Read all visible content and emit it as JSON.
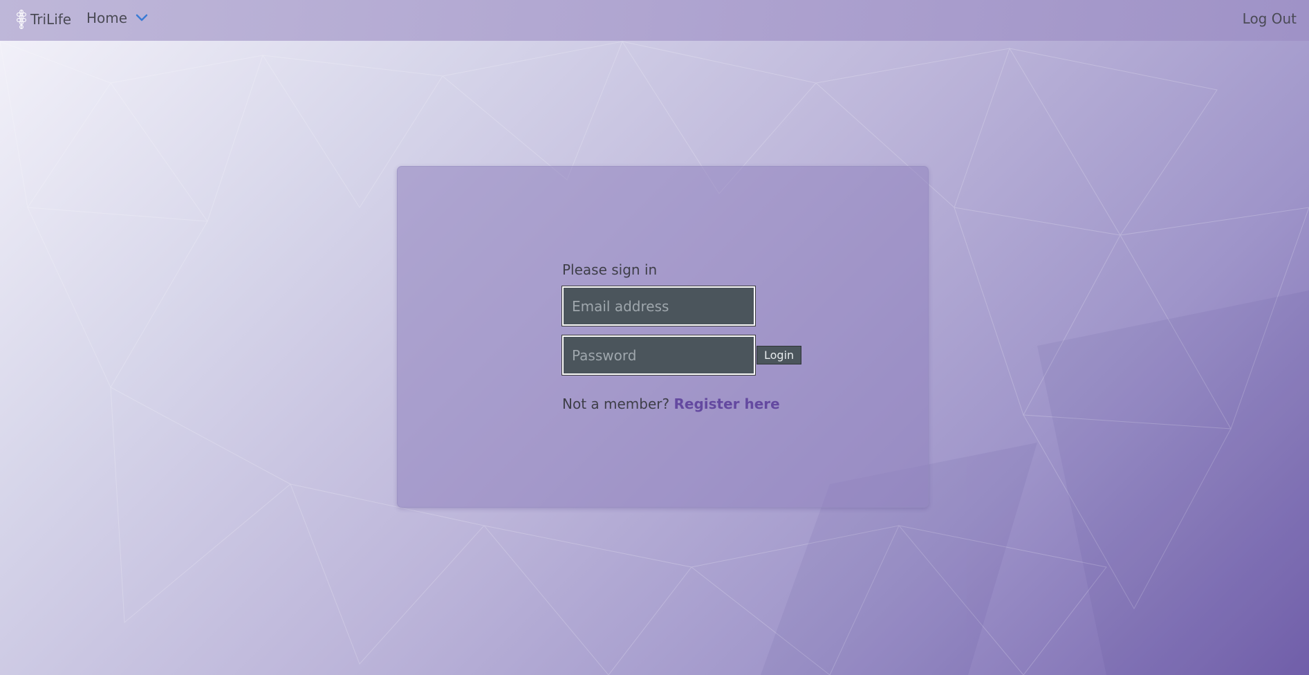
{
  "nav": {
    "brand": "TriLife",
    "home_label": "Home",
    "logout_label": "Log Out"
  },
  "login": {
    "heading": "Please sign in",
    "email_placeholder": "Email address",
    "email_value": "",
    "password_placeholder": "Password",
    "password_value": "",
    "submit_label": "Login",
    "register_prompt": "Not a member?",
    "register_link": "Register here"
  },
  "icons": {
    "brand": "trilife-logo-icon",
    "home_menu": "chevron-down-icon"
  },
  "colors": {
    "accent": "#3a7bd5",
    "link": "#6449a0",
    "input_bg": "#4b555c",
    "background_start": "#f4f3fa",
    "background_end": "#7563ad"
  }
}
